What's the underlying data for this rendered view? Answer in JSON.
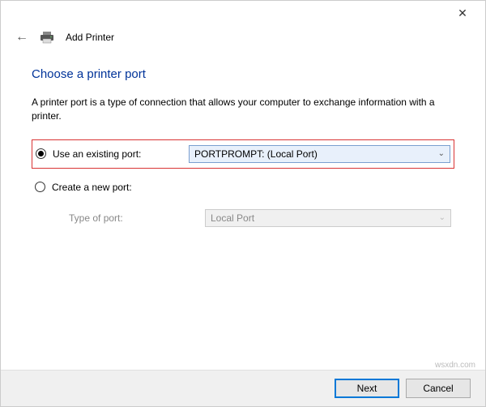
{
  "window": {
    "close_glyph": "✕",
    "back_glyph": "←",
    "title": "Add Printer"
  },
  "content": {
    "heading": "Choose a printer port",
    "description": "A printer port is a type of connection that allows your computer to exchange information with a printer."
  },
  "options": {
    "use_existing_label": "Use an existing port:",
    "use_existing_value": "PORTPROMPT: (Local Port)",
    "create_new_label": "Create a new port:",
    "type_of_port_label": "Type of port:",
    "type_of_port_value": "Local Port"
  },
  "footer": {
    "next": "Next",
    "cancel": "Cancel"
  },
  "watermark": "wsxdn.com"
}
